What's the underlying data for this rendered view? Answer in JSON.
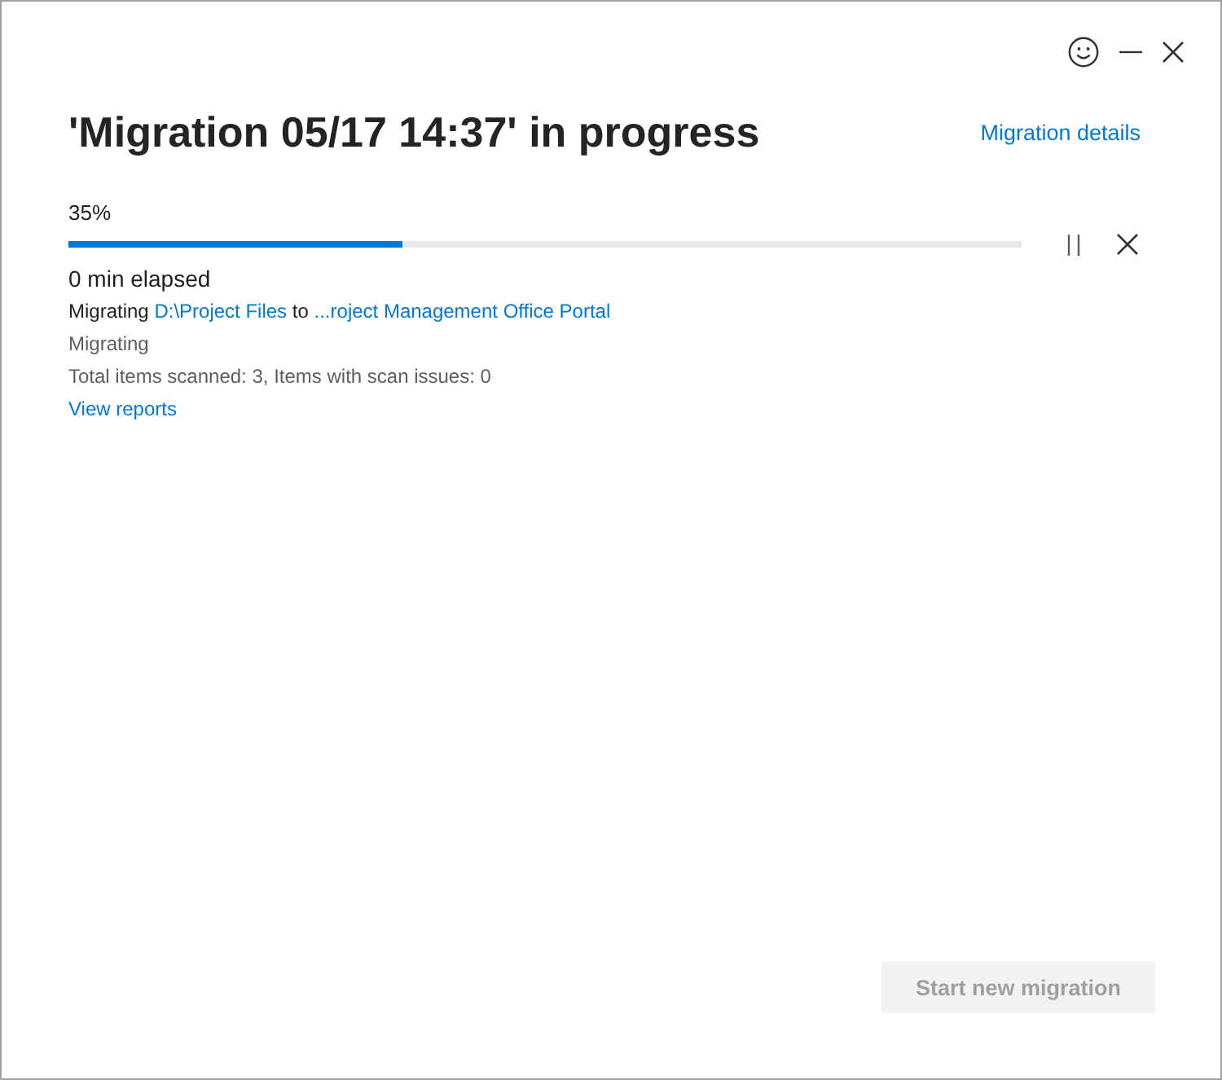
{
  "title": "'Migration 05/17 14:37' in progress",
  "details_link": "Migration details",
  "progress": {
    "percent": "35%",
    "level": 0.35,
    "elapsed": "0 min elapsed"
  },
  "route": {
    "prefix": "Migrating",
    "source": "D:\\Project Files",
    "connector": "to",
    "destination": "...roject Management Office Portal"
  },
  "status": "Migrating",
  "scan_summary": "Total items scanned: 3, Items with scan issues: 0",
  "reports_link": "View reports",
  "start_button": {
    "label": "Start new migration",
    "disabled": true
  }
}
